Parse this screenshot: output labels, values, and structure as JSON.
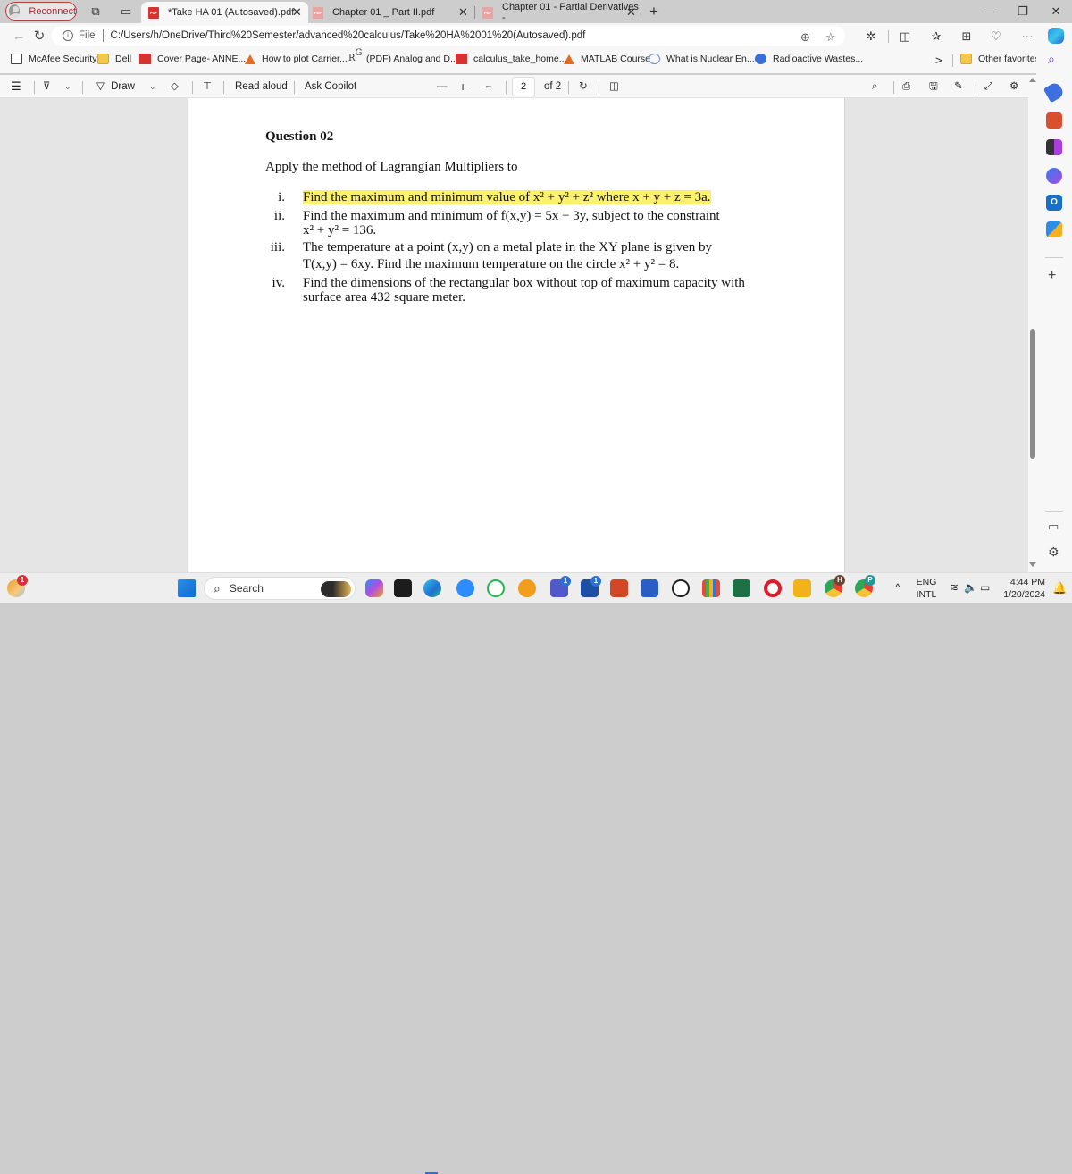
{
  "browser": {
    "reconnect_label": "Reconnect",
    "tabs": [
      {
        "title": "*Take HA 01 (Autosaved).pdf",
        "active": true
      },
      {
        "title": "Chapter 01 _ Part II.pdf",
        "active": false
      },
      {
        "title": "Chapter 01 - Partial Derivatives -",
        "active": false
      }
    ],
    "new_tab_label": "+",
    "window_controls": {
      "minimize": "—",
      "maximize": "❐",
      "close": "✕"
    },
    "address": {
      "scheme_label": "File",
      "url": "C:/Users/h/OneDrive/Third%20Semester/advanced%20calculus/Take%20HA%2001%20(Autosaved).pdf"
    },
    "favorites": [
      {
        "label": "McAfee Security",
        "icon": "page-icon"
      },
      {
        "label": "Dell",
        "icon": "folder-icon"
      },
      {
        "label": "Cover Page- ANNE...",
        "icon": "pdf-icon"
      },
      {
        "label": "How to plot Carrier...",
        "icon": "matlab-icon"
      },
      {
        "label": "(PDF) Analog and D...",
        "icon": "researchgate-icon"
      },
      {
        "label": "calculus_take_home...",
        "icon": "pdf-icon"
      },
      {
        "label": "MATLAB Course",
        "icon": "matlab-icon"
      },
      {
        "label": "What is Nuclear En...",
        "icon": "iaea-icon"
      },
      {
        "label": "Radioactive Wastes...",
        "icon": "radiation-icon"
      }
    ],
    "other_favorites_label": "Other favorites",
    "more_favorites_label": ">"
  },
  "reader_toolbar": {
    "draw_label": "Draw",
    "read_aloud_label": "Read aloud",
    "ask_copilot_label": "Ask Copilot",
    "zoom_out": "—",
    "zoom_in": "+",
    "current_page": "2",
    "page_count_label": "of 2"
  },
  "document": {
    "title": "Question 02",
    "intro": "Apply the method of Lagrangian Multipliers to",
    "items": [
      {
        "num": "i.",
        "lines": [
          "Find the maximum and minimum value of x² + y² + z² where x + y + z = 3a."
        ],
        "highlighted": true
      },
      {
        "num": "ii.",
        "lines": [
          "Find the maximum and minimum of f(x,y) = 5x − 3y, subject to the constraint",
          "x² + y² = 136."
        ],
        "highlighted": false
      },
      {
        "num": "iii.",
        "lines": [
          "The temperature at a point (x,y) on a metal plate in the XY plane is given by",
          "T(x,y) = 6xy. Find the maximum temperature on the circle x² + y² = 8."
        ],
        "highlighted": false
      },
      {
        "num": "iv.",
        "lines": [
          "Find the dimensions of the rectangular box without top of maximum capacity with",
          "surface area 432 square meter."
        ],
        "highlighted": false
      }
    ]
  },
  "taskbar": {
    "weather_badge": "1",
    "search_placeholder": "Search",
    "teams_badge": "1",
    "store_badge": "1",
    "chrome_profile_1": "H",
    "chrome_profile_2": "P",
    "language_line1": "ENG",
    "language_line2": "INTL",
    "time": "4:44 PM",
    "date": "1/20/2024"
  },
  "colors": {
    "highlight": "#fcf16b",
    "reconnect_red": "#c0393b",
    "pdf_red": "#d6322f"
  }
}
